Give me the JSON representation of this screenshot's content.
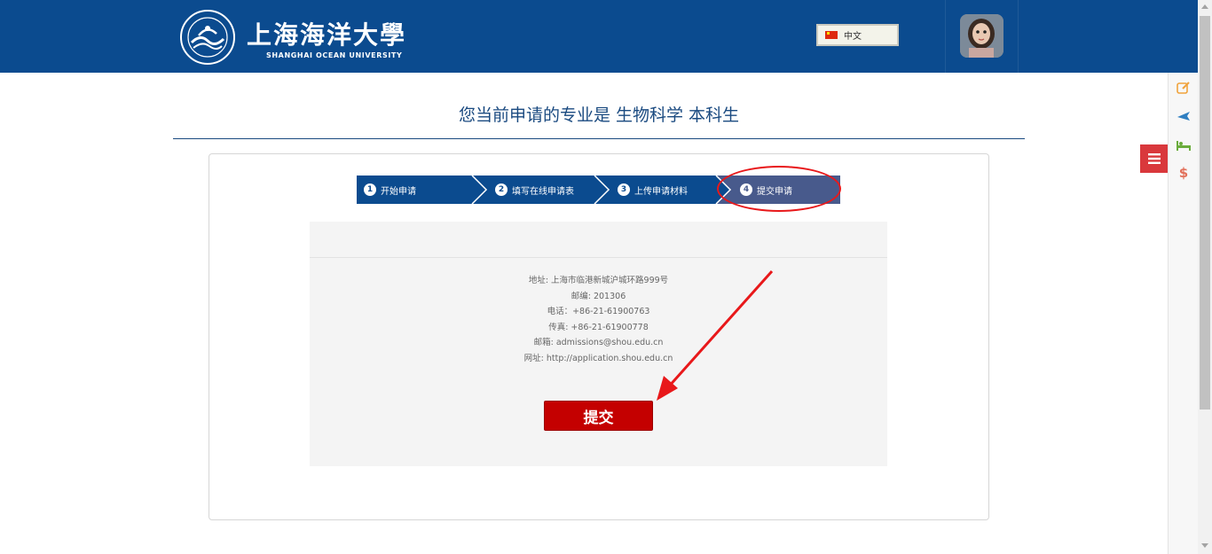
{
  "header": {
    "logo": {
      "name_cn": "上海海洋大學",
      "name_en": "SHANGHAI OCEAN UNIVERSITY"
    },
    "language": {
      "label": "中文",
      "flag": "china-flag-icon"
    }
  },
  "main": {
    "title": "您当前申请的专业是 生物科学 本科生",
    "steps": [
      {
        "number": "1",
        "label": "开始申请",
        "state": "done"
      },
      {
        "number": "2",
        "label": "填写在线申请表",
        "state": "done"
      },
      {
        "number": "3",
        "label": "上传申请材料",
        "state": "done"
      },
      {
        "number": "4",
        "label": "提交申请",
        "state": "current"
      }
    ],
    "contact": {
      "address": "地址: 上海市临港新城沪城环路999号",
      "postcode": "邮编: 201306",
      "phone": "电话：+86-21-61900763",
      "fax": "传真: +86-21-61900778",
      "email": "邮箱: admissions@shou.edu.cn",
      "website": "网址: http://application.shou.edu.cn"
    },
    "submit_label": "提交"
  },
  "side_dock": {
    "icons": [
      "edit-icon",
      "plane-icon",
      "bed-icon",
      "dollar-icon"
    ],
    "menu_icon": "hamburger-menu-icon"
  },
  "colors": {
    "header_bg": "#0b4b8f",
    "step_done": "#0b4b8f",
    "step_current": "#485a8c",
    "submit_bg": "#c40000",
    "annotation": "#e8181a"
  }
}
